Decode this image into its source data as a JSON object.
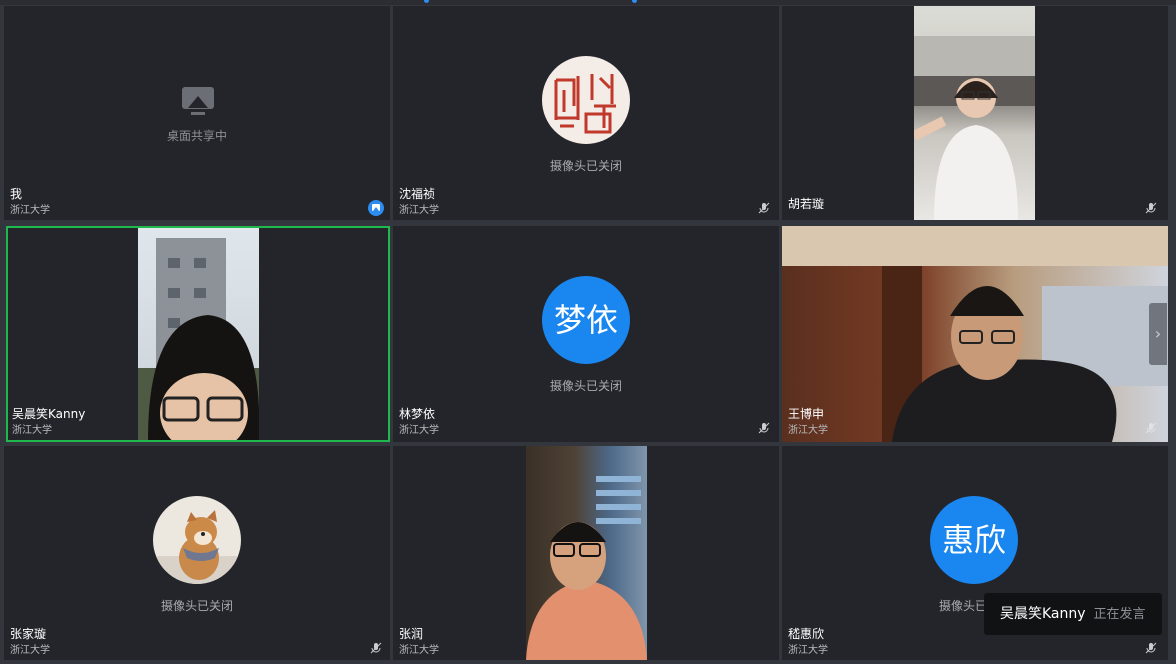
{
  "colors": {
    "background": "#33363d",
    "tile": "#23252a",
    "active_border": "#1fb84c",
    "avatar_blue": "#1a86f0"
  },
  "camera_off_text": "摄像头已关闭",
  "tiles": [
    {
      "name": "我",
      "org": "浙江大学",
      "status": "桌面共享中",
      "icon": "screen-share-icon"
    },
    {
      "name": "沈福祯",
      "org": "浙江大学",
      "status": "摄像头已关闭",
      "avatar": "seal-avatar"
    },
    {
      "name": "胡若璇",
      "org": "浙江大学"
    },
    {
      "name": "吴晨笑Kanny",
      "org": "浙江大学",
      "active": true
    },
    {
      "name": "林梦依",
      "org": "浙江大学",
      "status": "摄像头已关闭",
      "avatar_text": "梦依"
    },
    {
      "name": "王博申",
      "org": "浙江大学"
    },
    {
      "name": "张家璇",
      "org": "浙江大学",
      "status": "摄像头已关闭",
      "avatar": "dog-avatar"
    },
    {
      "name": "张润",
      "org": "浙江大学"
    },
    {
      "name": "嵇惠欣",
      "org": "浙江大学",
      "status": "摄像头已关闭",
      "avatar_text": "惠欣"
    }
  ],
  "speaking": {
    "name": "吴晨笑Kanny",
    "status": "正在发言"
  }
}
